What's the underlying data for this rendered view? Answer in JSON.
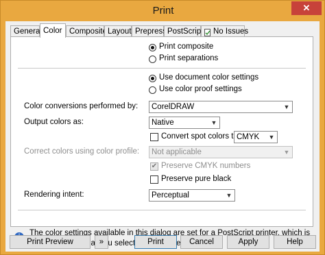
{
  "window": {
    "title": "Print",
    "close_glyph": "✕"
  },
  "tabs": [
    {
      "label": "General"
    },
    {
      "label": "Color"
    },
    {
      "label": "Composite"
    },
    {
      "label": "Layout"
    },
    {
      "label": "Prepress"
    },
    {
      "label": "PostScript"
    },
    {
      "label": "No Issues",
      "icon": "document-check-icon"
    }
  ],
  "active_tab": "Color",
  "color_output": {
    "options": [
      {
        "label": "Print composite",
        "selected": true
      },
      {
        "label": "Print separations",
        "selected": false
      }
    ]
  },
  "color_settings": {
    "options": [
      {
        "label": "Use document color settings",
        "selected": true
      },
      {
        "label": "Use color proof settings",
        "selected": false
      }
    ]
  },
  "conversions": {
    "label": "Color conversions performed by:",
    "value": "CorelDRAW"
  },
  "output_colors": {
    "label": "Output colors as:",
    "value": "Native"
  },
  "spot": {
    "checkbox_label": "Convert spot colors to:",
    "checked": false,
    "value": "CMYK"
  },
  "profile": {
    "label": "Correct colors using color profile:",
    "value": "Not applicable",
    "enabled": false
  },
  "preserve_cmyk": {
    "label": "Preserve CMYK numbers",
    "checked": true,
    "enabled": false,
    "mark": "✔"
  },
  "preserve_black": {
    "label": "Preserve pure black",
    "checked": false
  },
  "rendering": {
    "label": "Rendering intent:",
    "value": "Perceptual"
  },
  "info": {
    "icon": "info-icon",
    "glyph": "i",
    "text": "The color settings available in this dialog are set for a PostScript printer, which is the printer type that you selected on the General tab."
  },
  "buttons": {
    "print_preview": "Print Preview",
    "expand": "»",
    "print": "Print",
    "cancel": "Cancel",
    "apply": "Apply",
    "help": "Help"
  },
  "colors": {
    "title_bar": "#e9a840",
    "close": "#c7423a",
    "info_icon": "#2d67c2"
  }
}
